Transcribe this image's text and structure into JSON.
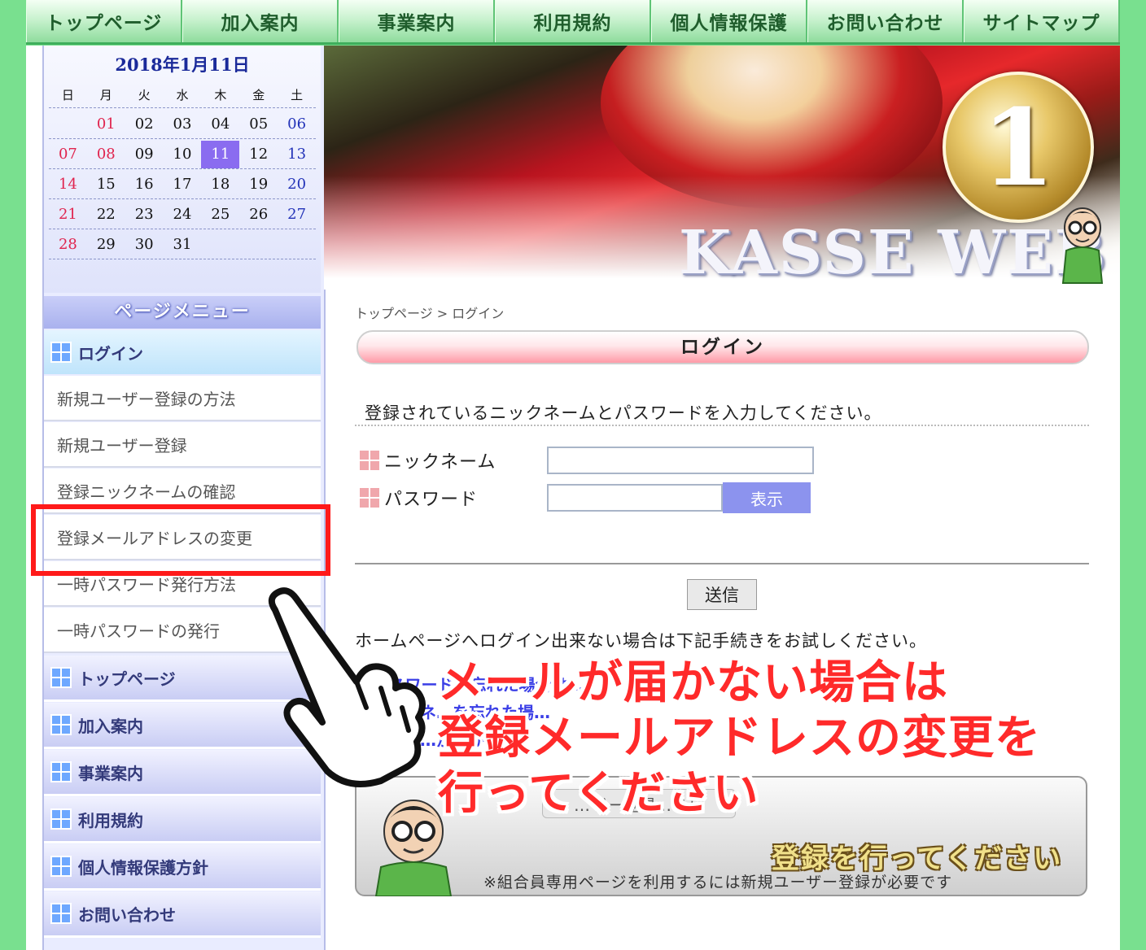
{
  "topnav": {
    "items": [
      "トップページ",
      "加入案内",
      "事業案内",
      "利用規約",
      "個人情報保護",
      "お問い合わせ",
      "サイトマップ"
    ]
  },
  "calendar": {
    "title": "2018年1月11日",
    "weekdays": [
      "日",
      "月",
      "火",
      "水",
      "木",
      "金",
      "土"
    ],
    "weeks": [
      [
        "",
        "01",
        "02",
        "03",
        "04",
        "05",
        "06"
      ],
      [
        "07",
        "08",
        "09",
        "10",
        "11",
        "12",
        "13"
      ],
      [
        "14",
        "15",
        "16",
        "17",
        "18",
        "19",
        "20"
      ],
      [
        "21",
        "22",
        "23",
        "24",
        "25",
        "26",
        "27"
      ],
      [
        "28",
        "29",
        "30",
        "31",
        "",
        "",
        ""
      ]
    ],
    "today": "11",
    "holidays": [
      "01",
      "08"
    ]
  },
  "sidebar": {
    "menu_title": "ページメニュー",
    "active_item": "ログイン",
    "sub_items": [
      "新規ユーザー登録の方法",
      "新規ユーザー登録",
      "登録ニックネームの確認",
      "登録メールアドレスの変更",
      "一時パスワード発行方法",
      "一時パスワードの発行"
    ],
    "main_items": [
      "トップページ",
      "加入案内",
      "事業案内",
      "利用規約",
      "個人情報保護方針",
      "お問い合わせ"
    ]
  },
  "banner": {
    "badge": "1",
    "logo": "KASSE WEB"
  },
  "content": {
    "breadcrumb": "トップページ > ログイン",
    "heading": "ログイン",
    "instruction": "登録されているニックネームとパスワードを入力してください。",
    "nickname_label": "ニックネーム",
    "password_label": "パスワード",
    "nickname_value": "",
    "password_value": "",
    "show_button": "表示",
    "submit_button": "送信",
    "help_text": "ホームページへログイン出来ない場合は下記手続きをお試しください。",
    "help_links": [
      "●パスワードを忘れた場合は…",
      "ニックネ…を忘れた場…",
      "登録メ…が届か…"
    ],
    "register_banner": {
      "button": "…ザー登録…ちら",
      "big_text": "登録を行ってください",
      "note": "※組合員専用ページを利用するには新規ユーザー登録が必要です"
    }
  },
  "annotation": {
    "callout_lines": [
      "メールが届かない場合は",
      "登録メールアドレスの変更を",
      "行ってください"
    ],
    "color": "#ff2a2a"
  }
}
